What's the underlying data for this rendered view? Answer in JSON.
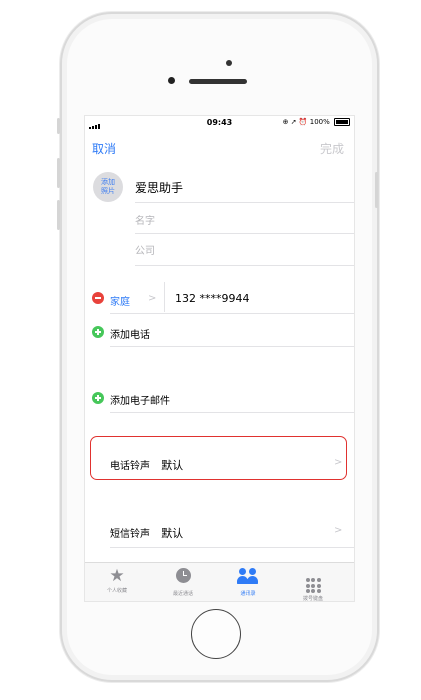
{
  "status": {
    "time": "09:43",
    "battery": "100%"
  },
  "nav": {
    "cancel": "取消",
    "done": "完成"
  },
  "photo": {
    "line1": "添加",
    "line2": "照片"
  },
  "contact": {
    "name": "爱思助手",
    "name_placeholder": "名字",
    "company_placeholder": "公司"
  },
  "phone_row": {
    "label": "家庭",
    "chevron": ">",
    "number": "132 ****9944"
  },
  "add_phone": "添加电话",
  "add_email": "添加电子邮件",
  "ringtone": {
    "label": "电话铃声",
    "value": "默认",
    "chevron": ">"
  },
  "text_tone": {
    "label": "短信铃声",
    "value": "默认",
    "chevron": ">"
  },
  "tabs": [
    {
      "label": "个人收藏",
      "icon": "star-icon",
      "active": false
    },
    {
      "label": "最近通话",
      "icon": "clock-icon",
      "active": false
    },
    {
      "label": "通讯录",
      "icon": "contacts-icon",
      "active": true
    },
    {
      "label": "拨号键盘",
      "icon": "keypad-icon",
      "active": false
    }
  ],
  "colors": {
    "accent": "#2f7bf6",
    "delete": "#e8423b",
    "add": "#46c75a",
    "highlight_border": "#e0322f"
  }
}
